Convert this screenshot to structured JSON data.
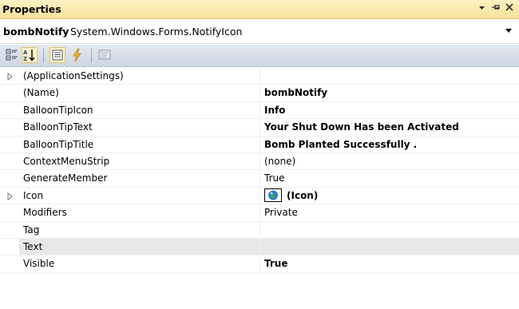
{
  "titlebar": {
    "title": "Properties",
    "controls": [
      "dropdown-arrow",
      "pin",
      "close"
    ]
  },
  "object_selector": {
    "name": "bombNotify",
    "type": "System.Windows.Forms.NotifyIcon"
  },
  "toolbar": {
    "buttons": [
      "categorized-icon",
      "alphabetical-icon",
      "properties-icon",
      "events-icon",
      "property-pages-icon"
    ],
    "active": [
      "alphabetical-icon",
      "properties-icon"
    ]
  },
  "properties": [
    {
      "name": "(ApplicationSettings)",
      "value": "",
      "bold": false,
      "expandable": true
    },
    {
      "name": "(Name)",
      "value": "bombNotify",
      "bold": true,
      "expandable": false
    },
    {
      "name": "BalloonTipIcon",
      "value": "Info",
      "bold": true,
      "expandable": false
    },
    {
      "name": "BalloonTipText",
      "value": "Your Shut Down Has been Activated",
      "bold": true,
      "expandable": false
    },
    {
      "name": "BalloonTipTitle",
      "value": "Bomb Planted Successfully .",
      "bold": true,
      "expandable": false
    },
    {
      "name": "ContextMenuStrip",
      "value": "(none)",
      "bold": false,
      "expandable": false
    },
    {
      "name": "GenerateMember",
      "value": "True",
      "bold": false,
      "expandable": false
    },
    {
      "name": "Icon",
      "value": "(Icon)",
      "bold": true,
      "expandable": true,
      "has_icon_preview": true
    },
    {
      "name": "Modifiers",
      "value": "Private",
      "bold": false,
      "expandable": false
    },
    {
      "name": "Tag",
      "value": "",
      "bold": false,
      "expandable": false
    },
    {
      "name": "Text",
      "value": "",
      "bold": false,
      "expandable": false,
      "selected": true
    },
    {
      "name": "Visible",
      "value": "True",
      "bold": true,
      "expandable": false
    }
  ],
  "colors": {
    "titlebar_top": "#fdf2c3",
    "titlebar_bottom": "#f7e19b",
    "toolbar": "#cfd6e2",
    "selected_row": "#e8e8e8"
  }
}
